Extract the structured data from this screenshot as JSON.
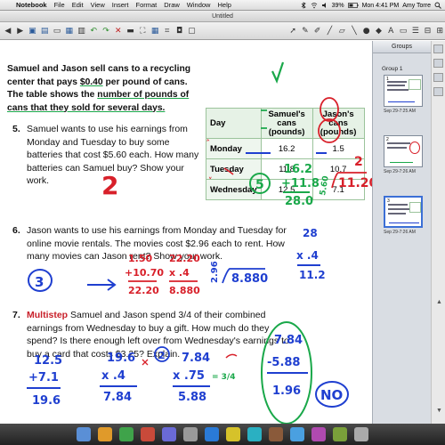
{
  "menubar": {
    "app": "Notebook",
    "items": [
      "File",
      "Edit",
      "View",
      "Insert",
      "Format",
      "Draw",
      "Window",
      "Help"
    ],
    "battery": "39%",
    "clock": "Mon 4:41 PM",
    "user": "Amy Torre"
  },
  "window": {
    "title": "Untitled"
  },
  "sidebar": {
    "header": "Groups",
    "group_label": "Group 1",
    "pages": [
      {
        "number": "1",
        "caption": "Sep 29-7:25 AM"
      },
      {
        "number": "2",
        "caption": "Sep 29-7:26 AM"
      },
      {
        "number": "3",
        "caption": "Sep 29-7:26 AM"
      }
    ]
  },
  "problem": {
    "intro_pre": "Samuel and Jason sell cans to a recycling center that pays ",
    "intro_price": "$0.40",
    "intro_mid": " per pound of cans. The table shows the ",
    "intro_bold": "number of pounds of cans that they sold for several days.",
    "q5_num": "5.",
    "q5_text": "Samuel wants to use his earnings from Monday and Tuesday to buy some batteries that cost $5.60 each. How many batteries can Samuel buy? Show your work.",
    "q6_num": "6.",
    "q6_text": "Jason wants to use his earnings from Monday and Tuesday for online movie rentals. The movies cost $2.96 each to rent. How many movies can Jason rent? Show your work.",
    "q7_num": "7.",
    "q7_tag": "Multistep",
    "q7_text": "Samuel and Jason spend 3/4 of their combined earnings from Wednesday to buy a gift. How much do they spend? Is there enough left over from Wednesday's earnings to buy a card that costs $3.25? Explain."
  },
  "table": {
    "headers": [
      "Day",
      "Samuel's cans (pounds)",
      "Jason's cans (pounds)"
    ],
    "rows": [
      {
        "day": "Monday",
        "samuel": "16.2",
        "jason": "1.5"
      },
      {
        "day": "Tuesday",
        "samuel": "11.8",
        "jason": "10.7"
      },
      {
        "day": "Wednesday",
        "samuel": "12.5",
        "jason": "7.1"
      }
    ]
  },
  "handwriting": {
    "q5_answer": "2",
    "q5_circle": "5",
    "q5_sum_a": "16.2",
    "q5_sum_b": "+11.8",
    "q5_sum_total": "28.0",
    "q5_div_divisor": "5.60",
    "q5_div_dividend": "11.20",
    "q5_div_quotient": "2",
    "q5_right_1": "28",
    "q5_right_2": "x .4",
    "q5_right_3": "11.2",
    "q6_circle": "3",
    "q6_sum_a": "1.50",
    "q6_sum_b": "+10.70",
    "q6_sum_total": "22.20",
    "q6_mult_a": "22.20",
    "q6_mult_b": "x .4",
    "q6_mult_total": "8.880",
    "q6_div_divisor": "2.96",
    "q6_div_dividend": "8.880",
    "q6_div_quotient": "3",
    "q7_circle": "2",
    "q7_sum_a": "12.5",
    "q7_sum_b": "+7.1",
    "q7_sum_total": "19.6",
    "q7_mult_a": "19.6",
    "q7_mult_b": "x .4",
    "q7_mult_total": "7.84",
    "q7_mult2_a": "7.84",
    "q7_mult2_b": "x .75",
    "q7_mult2_total": "5.88",
    "q7_frac": "= 3/4",
    "q7_sub_a": "7.84",
    "q7_sub_b": "-5.88",
    "q7_sub_total": "1.96",
    "q7_answer": "NO"
  },
  "colors": {
    "ink_blue": "#1f3fd0",
    "ink_green": "#1aa84a",
    "ink_red": "#d8202a",
    "table_border": "#9bc39b"
  }
}
